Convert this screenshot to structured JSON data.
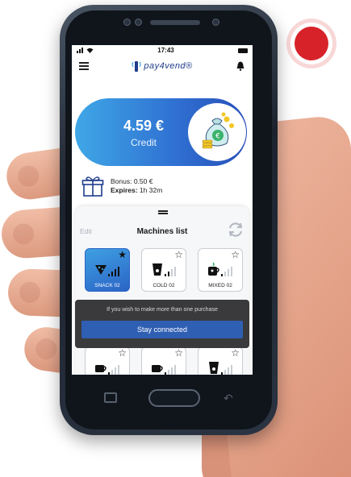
{
  "statusbar": {
    "time": "17:43"
  },
  "app": {
    "logo_text": "pay4vend®"
  },
  "credit": {
    "amount": "4.59 €",
    "label": "Credit"
  },
  "bonus": {
    "bonus_line": "Bonus: 0.50 €",
    "expires_label": "Expires:",
    "expires_value": "1h 32m"
  },
  "machines": {
    "edit_label": "Edit",
    "title": "Machines list",
    "tiles": [
      {
        "label": "SNACK 02",
        "icon": "snack-icon",
        "selected": true,
        "favorite": true
      },
      {
        "label": "COLD 02",
        "icon": "cold-drink-icon",
        "selected": false,
        "favorite": false
      },
      {
        "label": "MIXED 02",
        "icon": "mixed-icon",
        "selected": false,
        "favorite": false
      },
      {
        "label": "",
        "icon": "coffee-icon",
        "selected": false,
        "favorite": false
      },
      {
        "label": "",
        "icon": "coffee-icon",
        "selected": false,
        "favorite": false
      },
      {
        "label": "",
        "icon": "cold-drink-icon",
        "selected": false,
        "favorite": false
      }
    ]
  },
  "toast": {
    "message": "If you wish to make more than one purchase",
    "button_label": "Stay connected"
  },
  "colors": {
    "accent": "#2f6fd1",
    "record": "#d82229",
    "toast": "#3a3a3c"
  }
}
